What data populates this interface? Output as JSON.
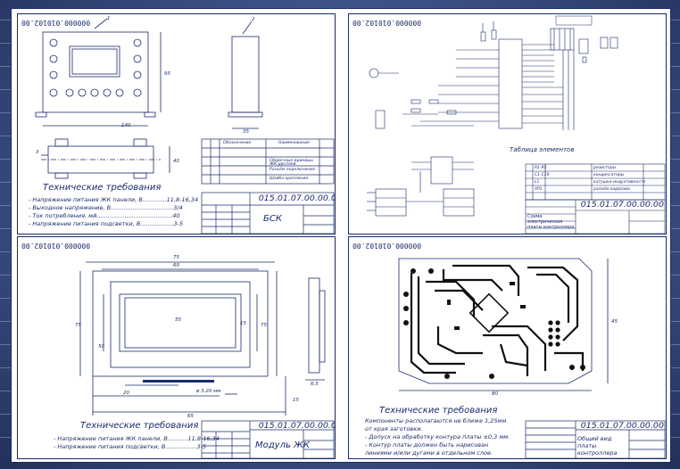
{
  "background_color": "#3f5387",
  "line_color": "#1a2a6a",
  "sheets": {
    "top_left": {
      "header_code": "000000.010102.00",
      "stamp_code": "015.01.07.00.00.00",
      "stamp_name": "БСК",
      "requirements_title": "Технические требования",
      "requirements": [
        "- Напряжение питания ЖК панели, В.............11,8-16,34",
        "- Выходное напряжение, В..................................3/4",
        "- Ток потребления, мА.........................................40",
        "- Напряжение питания подсветки, В..................3-5"
      ],
      "spec_header": [
        "Обозначение",
        "Наименование"
      ],
      "spec_rows": [
        "Сборочные единицы",
        "ЖК дисплей",
        "Разъём подключения",
        "Шайба крепления"
      ],
      "dims": [
        "140",
        "95",
        "35",
        "40"
      ],
      "callouts": [
        "1",
        "2",
        "3"
      ]
    },
    "top_right": {
      "header_code": "000000.010102.00",
      "table_title": "Таблица элементов",
      "stamp_code": "015.01.07.00.00.00",
      "stamp_name": "Схема электрическая платы контроллера",
      "elements": [
        "резисторы",
        "конденсаторы",
        "катушки индуктивности",
        "разъём коррозии"
      ],
      "element_refs": [
        "R1-R5",
        "C1-C10",
        "L1",
        "XP1"
      ]
    },
    "bottom_left": {
      "header_code": "000000.010102.00",
      "stamp_code": "015.01.07.00.00.00",
      "stamp_name": "Модуль ЖК",
      "requirements_title": "Технические требования",
      "requirements": [
        "- Напряжение питания ЖК панели, В...........11,8-16,34",
        "- Напряжение питания подсветки, В.................3-5"
      ],
      "dims": [
        "75",
        "60",
        "55",
        "75",
        "50",
        "75",
        "15",
        "20",
        "65",
        "6,5",
        "15"
      ],
      "hole_note": "ø 3.20 мм"
    },
    "bottom_right": {
      "header_code": "000000.010102.00",
      "stamp_code": "015.01.07.00.00.00",
      "stamp_name": "Общий вид платы контроллера",
      "requirements_title": "Технические требования",
      "requirements": [
        "Компоненты располагаются не ближе 1,25мм",
        "от края заготовки.",
        "- Допуск на обработку контура платы ±0,3 мм.",
        "- Контур платы должен быть нарисован",
        "линиями и/или дугами в отдельном слое."
      ],
      "dims": [
        "80",
        "45"
      ]
    }
  }
}
